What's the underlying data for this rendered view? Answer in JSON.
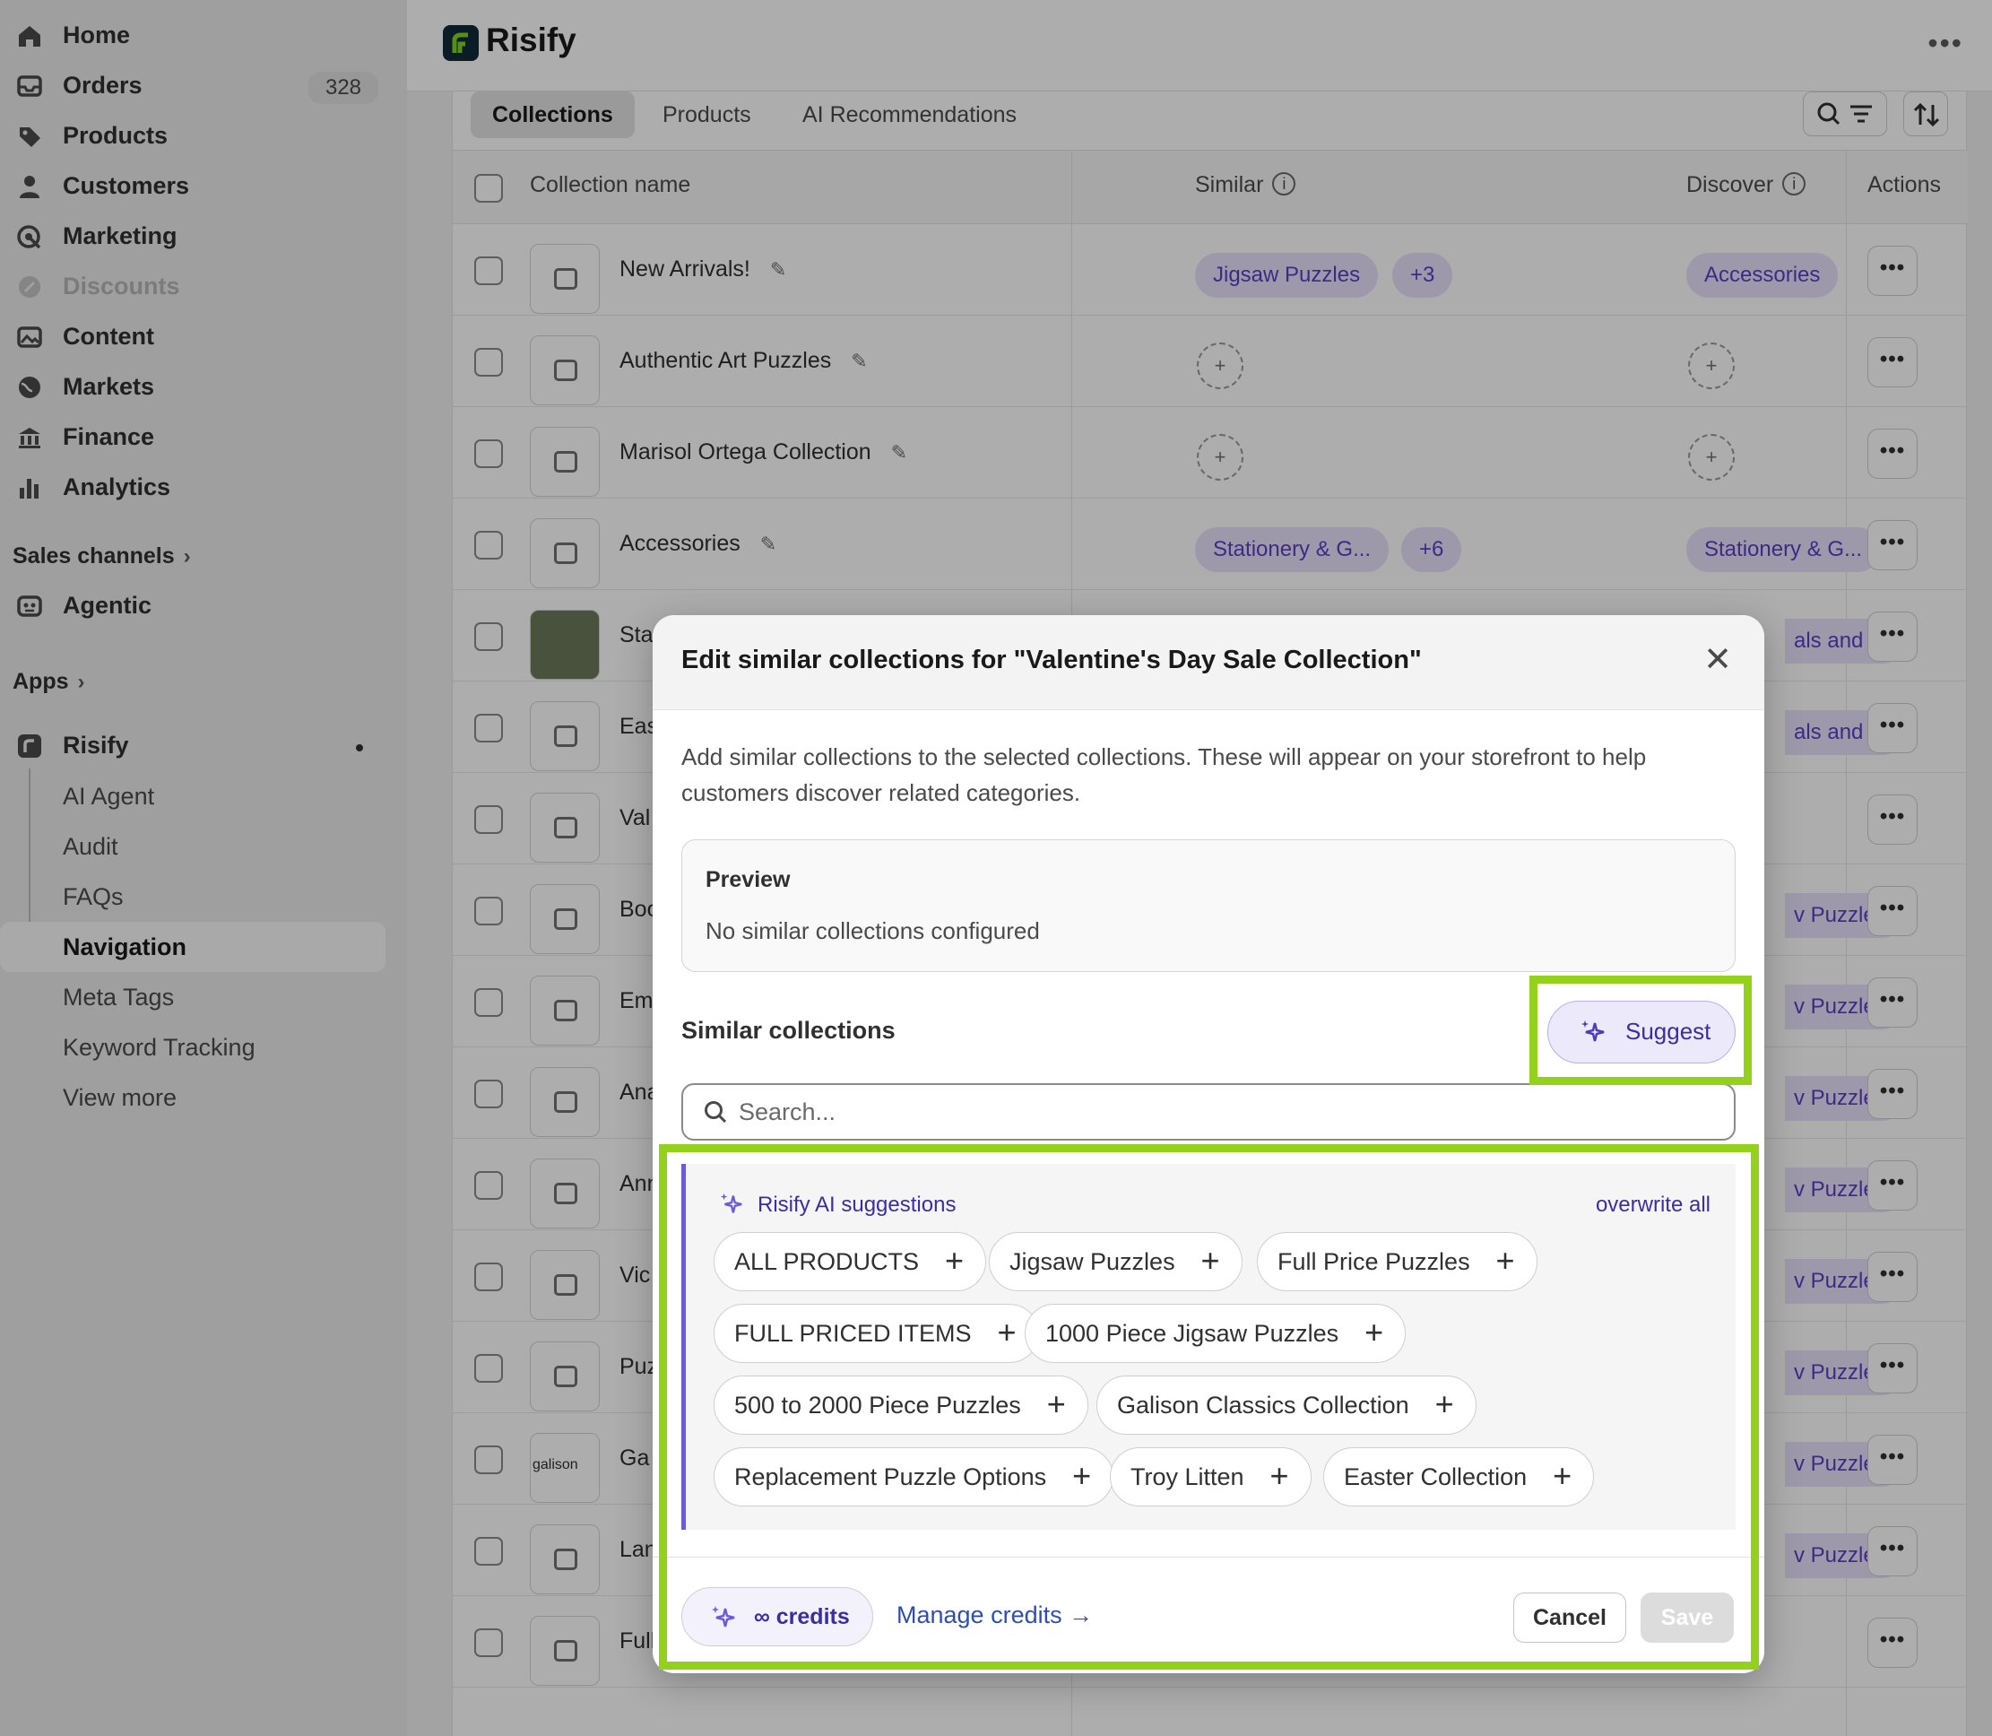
{
  "sidebar": {
    "nav": [
      {
        "label": "Home",
        "icon": "home-icon"
      },
      {
        "label": "Orders",
        "icon": "inbox-icon",
        "badge": "328"
      },
      {
        "label": "Products",
        "icon": "tag-icon"
      },
      {
        "label": "Customers",
        "icon": "person-icon"
      },
      {
        "label": "Marketing",
        "icon": "target-icon"
      },
      {
        "label": "Discounts",
        "icon": "discount-icon",
        "disabled": true
      },
      {
        "label": "Content",
        "icon": "image-icon"
      },
      {
        "label": "Markets",
        "icon": "globe-icon"
      },
      {
        "label": "Finance",
        "icon": "bank-icon"
      },
      {
        "label": "Analytics",
        "icon": "bar-chart-icon"
      }
    ],
    "sales_channels_label": "Sales channels",
    "agentic_label": "Agentic",
    "apps_label": "Apps",
    "app_name": "Risify",
    "app_sub_items": [
      "AI Agent",
      "Audit",
      "FAQs",
      "Navigation",
      "Meta Tags",
      "Keyword Tracking",
      "View more"
    ],
    "active_sub_item": "Navigation"
  },
  "topbar": {
    "title": "Risify",
    "more_icon": "more-horizontal-icon"
  },
  "main": {
    "tabs": [
      "Collections",
      "Products",
      "AI Recommendations"
    ],
    "active_tab": "Collections",
    "columns": {
      "name": "Collection name",
      "similar": "Similar",
      "discover": "Discover",
      "actions": "Actions"
    },
    "rows": [
      {
        "name": "New Arrivals!",
        "similar": [
          "Jigsaw Puzzles",
          "+3"
        ],
        "discover": [
          "Accessories"
        ]
      },
      {
        "name": "Authentic Art Puzzles",
        "similar": [],
        "discover": []
      },
      {
        "name": "Marisol Ortega Collection",
        "similar": [],
        "discover": []
      },
      {
        "name": "Accessories",
        "similar": [
          "Stationery & G...",
          "+6"
        ],
        "discover": [
          "Stationery & G..."
        ]
      },
      {
        "name": "Sta",
        "discover": [
          "als and ..."
        ]
      },
      {
        "name": "Eas",
        "discover": [
          "als and ..."
        ]
      },
      {
        "name": "Val",
        "discover": []
      },
      {
        "name": "Boo",
        "discover": [
          "v Puzzles"
        ]
      },
      {
        "name": "Em",
        "discover": [
          "v Puzzles"
        ]
      },
      {
        "name": "Ana",
        "discover": [
          "v Puzzles"
        ]
      },
      {
        "name": "Ann",
        "discover": [
          "v Puzzles"
        ]
      },
      {
        "name": "Vic",
        "discover": [
          "v Puzzles"
        ]
      },
      {
        "name": "Puz",
        "discover": [
          "v Puzzles"
        ]
      },
      {
        "name": "Ga",
        "discover": [
          "v Puzzles"
        ],
        "thumb_text": "galison"
      },
      {
        "name": "Lan",
        "discover": [
          "v Puzzles"
        ]
      },
      {
        "name": "Full",
        "discover": []
      }
    ]
  },
  "modal": {
    "title": "Edit similar collections for \"Valentine's Day Sale Collection\"",
    "description": "Add similar collections to the selected collections. These will appear on your storefront to help customers discover related categories.",
    "preview_title": "Preview",
    "preview_empty": "No similar collections configured",
    "similar_label": "Similar collections",
    "suggest_label": "Suggest",
    "search_placeholder": "Search...",
    "ai_title": "Risify AI suggestions",
    "overwrite_label": "overwrite all",
    "suggestions": [
      "ALL PRODUCTS",
      "Jigsaw Puzzles",
      "Full Price Puzzles",
      "FULL PRICED ITEMS",
      "1000 Piece Jigsaw Puzzles",
      "500 to 2000 Piece Puzzles",
      "Galison Classics Collection",
      "Replacement Puzzle Options",
      "Troy Litten",
      "Easter Collection"
    ],
    "credits_label": "∞ credits",
    "manage_credits_label": "Manage credits →",
    "cancel_label": "Cancel",
    "save_label": "Save"
  },
  "colors": {
    "accent_purple": "#5c3fc4",
    "highlight_green": "#94d11c",
    "logo_green": "#7ed321"
  }
}
